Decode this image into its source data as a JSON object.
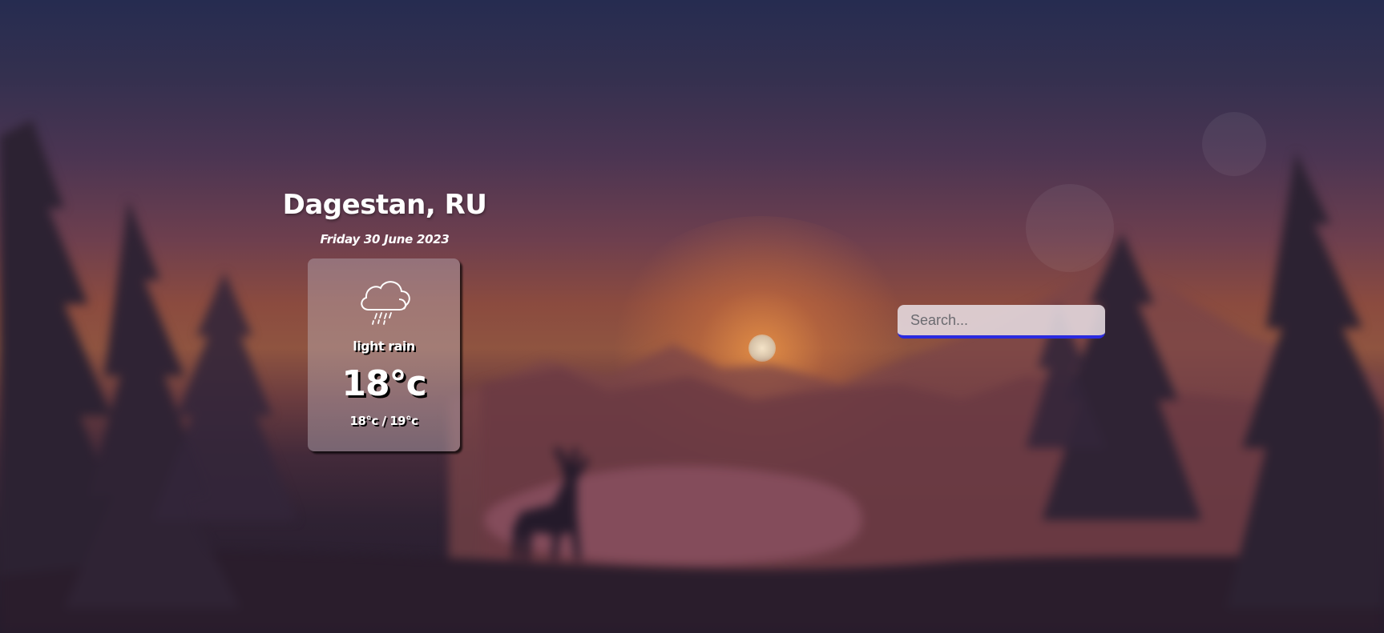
{
  "weather": {
    "location": "Dagestan, RU",
    "date": "Friday 30 June 2023",
    "description": "light rain",
    "temperature": "18°c",
    "min_max": "18°c / 19°c",
    "icon": "cloud-rain-icon"
  },
  "search": {
    "placeholder": "Search...",
    "value": ""
  },
  "colors": {
    "search_underline": "#2a2adf",
    "text": "#ffffff"
  }
}
